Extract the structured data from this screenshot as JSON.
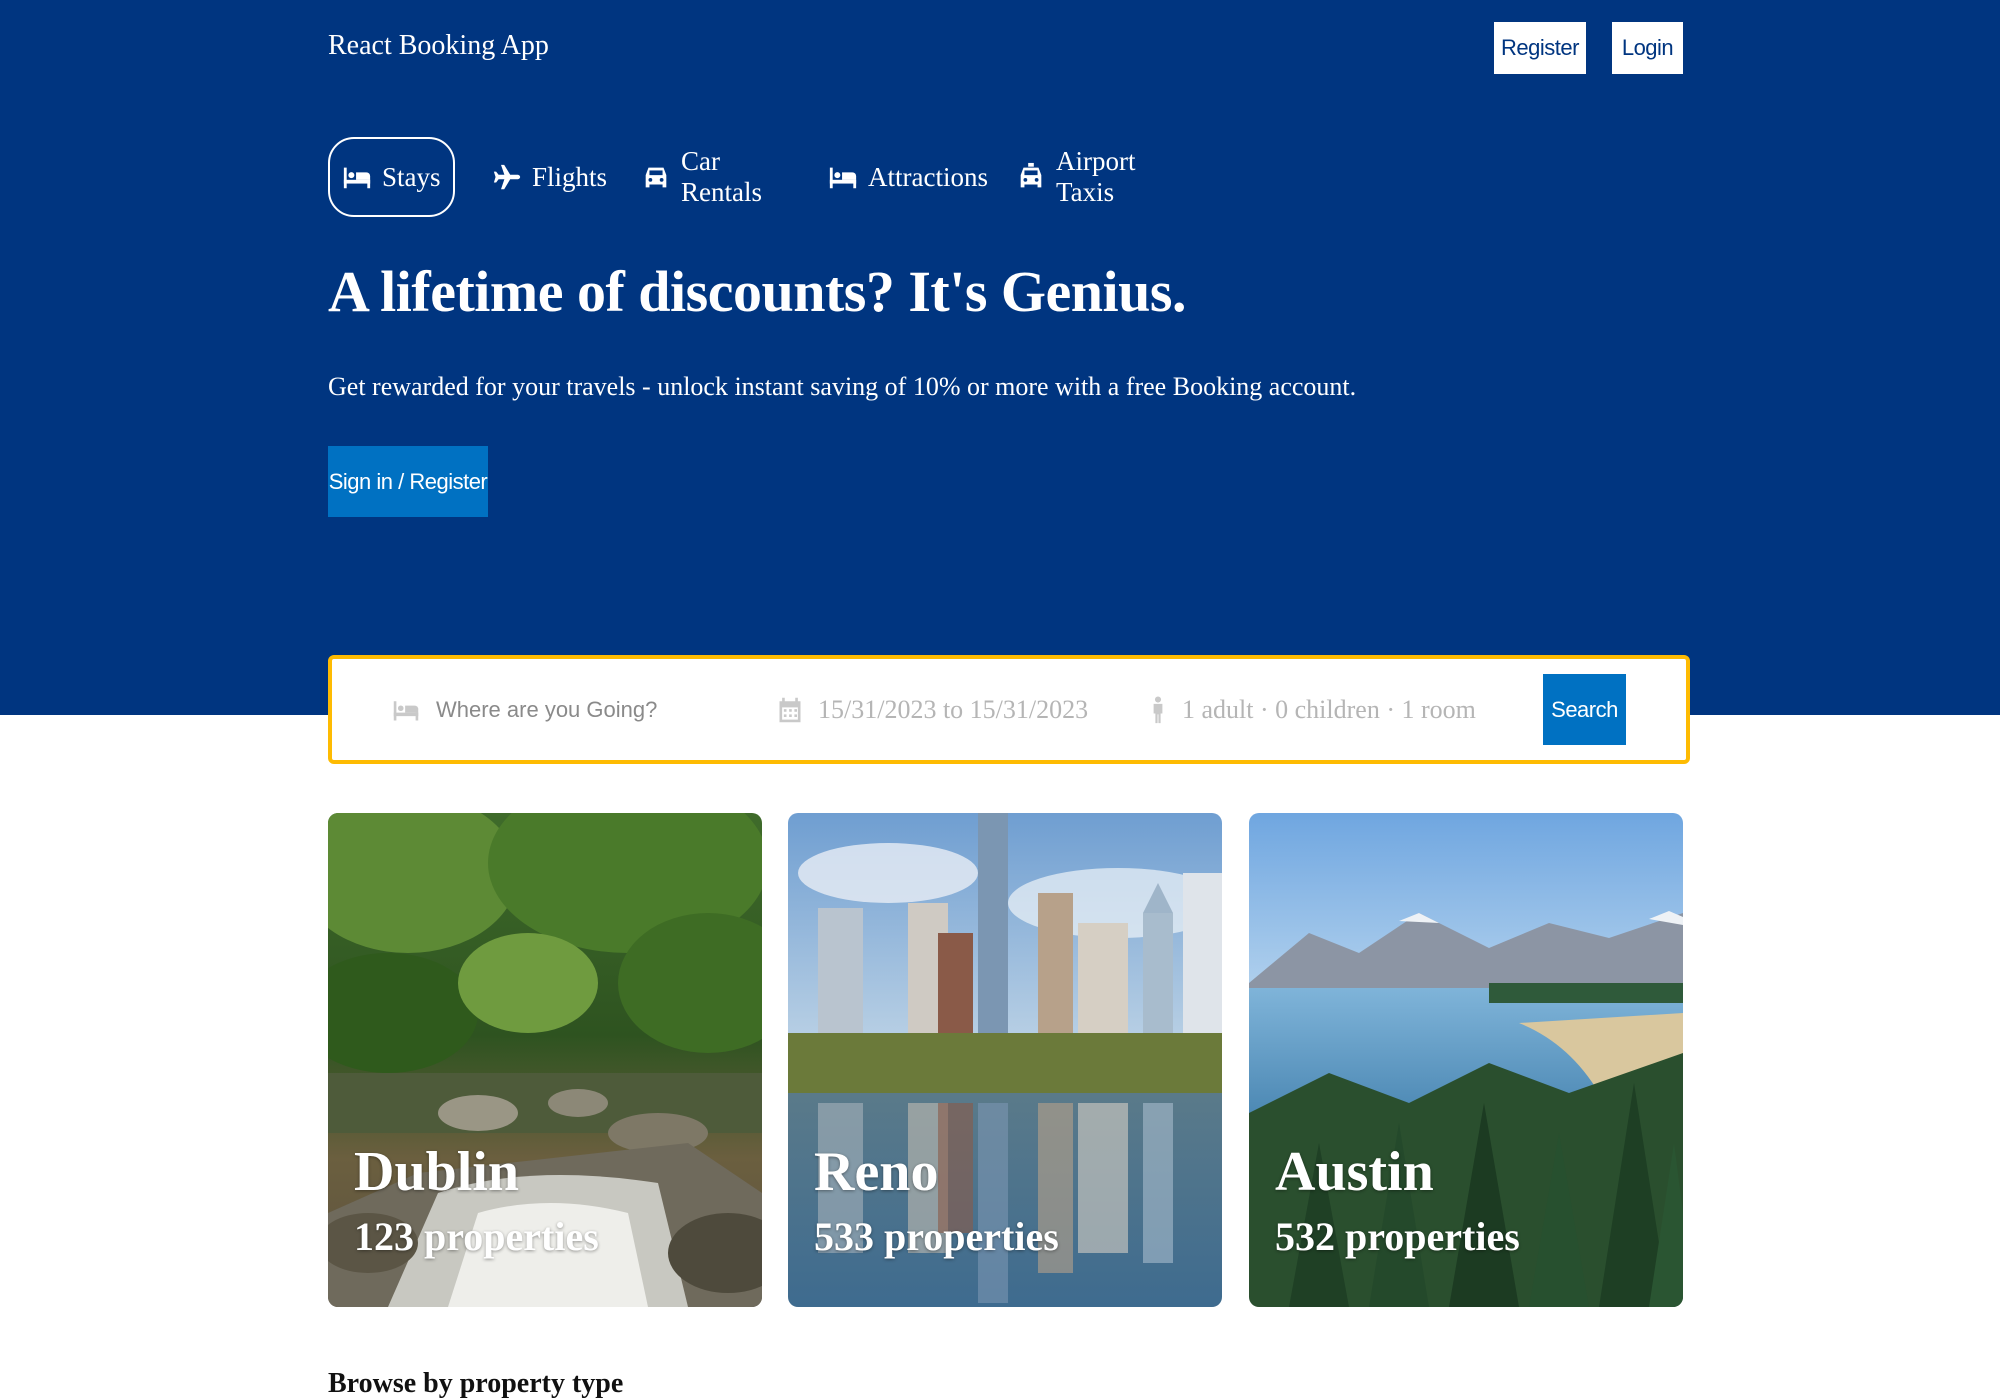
{
  "header": {
    "brand": "React Booking App",
    "register_label": "Register",
    "login_label": "Login"
  },
  "nav": {
    "items": [
      {
        "label": "Stays",
        "icon": "bed-icon",
        "active": true
      },
      {
        "label": "Flights",
        "icon": "plane-icon",
        "active": false
      },
      {
        "label": "Car Rentals",
        "icon": "car-icon",
        "active": false
      },
      {
        "label": "Attractions",
        "icon": "bed-icon",
        "active": false
      },
      {
        "label": "Airport Taxis",
        "icon": "taxi-icon",
        "active": false
      }
    ]
  },
  "hero": {
    "title": "A lifetime of discounts? It's Genius.",
    "description": "Get rewarded for your travels - unlock instant saving of 10% or more with a free Booking account.",
    "cta_label": "Sign in / Register"
  },
  "search": {
    "destination_placeholder": "Where are you Going?",
    "dates": "15/31/2023 to 15/31/2023",
    "guests": "1 adult · 0 children · 1 room",
    "button_label": "Search"
  },
  "featured": [
    {
      "city": "Dublin",
      "properties": "123 properties"
    },
    {
      "city": "Reno",
      "properties": "533 properties"
    },
    {
      "city": "Austin",
      "properties": "532 properties"
    }
  ],
  "sections": {
    "property_type_title": "Browse by property type"
  },
  "colors": {
    "brand_blue": "#003580",
    "button_blue": "#0071c2",
    "search_border": "#febb02"
  }
}
